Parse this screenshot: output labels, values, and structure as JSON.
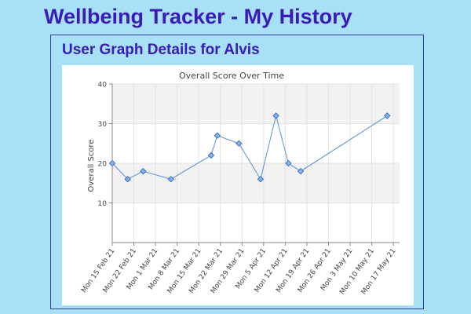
{
  "header": {
    "title": "Wellbeing Tracker - My History"
  },
  "panel": {
    "title": "User Graph Details for Alvis"
  },
  "colors": {
    "background": "#a8e0f5",
    "heading": "#3a1bb8",
    "line": "#5b8fd6",
    "marker": "#7fb2f0"
  },
  "chart_data": {
    "type": "line",
    "title": "Overall Score Over Time",
    "xlabel": "",
    "ylabel": "Overall Score",
    "ylim": [
      0,
      40
    ],
    "yticks": [
      10,
      20,
      30,
      40
    ],
    "grid": true,
    "x_ticks": [
      "Mon 15 Feb 21",
      "Mon 22 Feb 21",
      "Mon 1 Mar 21",
      "Mon 8 Mar 21",
      "Mon 15 Mar 21",
      "Mon 22 Mar 21",
      "Mon 29 Mar 21",
      "Mon 5 Apr 21",
      "Mon 12 Apr 21",
      "Mon 19 Apr 21",
      "Mon 26 Apr 21",
      "Mon 3 May 21",
      "Mon 10 May 21",
      "Mon 17 May 21"
    ],
    "x_range": [
      "2021-02-15",
      "2021-05-19"
    ],
    "series": [
      {
        "points": [
          {
            "x": "2021-02-15",
            "y": 20
          },
          {
            "x": "2021-02-20",
            "y": 16
          },
          {
            "x": "2021-02-25",
            "y": 18
          },
          {
            "x": "2021-03-06",
            "y": 16
          },
          {
            "x": "2021-03-19",
            "y": 22
          },
          {
            "x": "2021-03-21",
            "y": 27
          },
          {
            "x": "2021-03-28",
            "y": 25
          },
          {
            "x": "2021-04-04",
            "y": 16
          },
          {
            "x": "2021-04-09",
            "y": 32
          },
          {
            "x": "2021-04-13",
            "y": 20
          },
          {
            "x": "2021-04-17",
            "y": 18
          },
          {
            "x": "2021-05-15",
            "y": 32
          }
        ]
      }
    ]
  }
}
